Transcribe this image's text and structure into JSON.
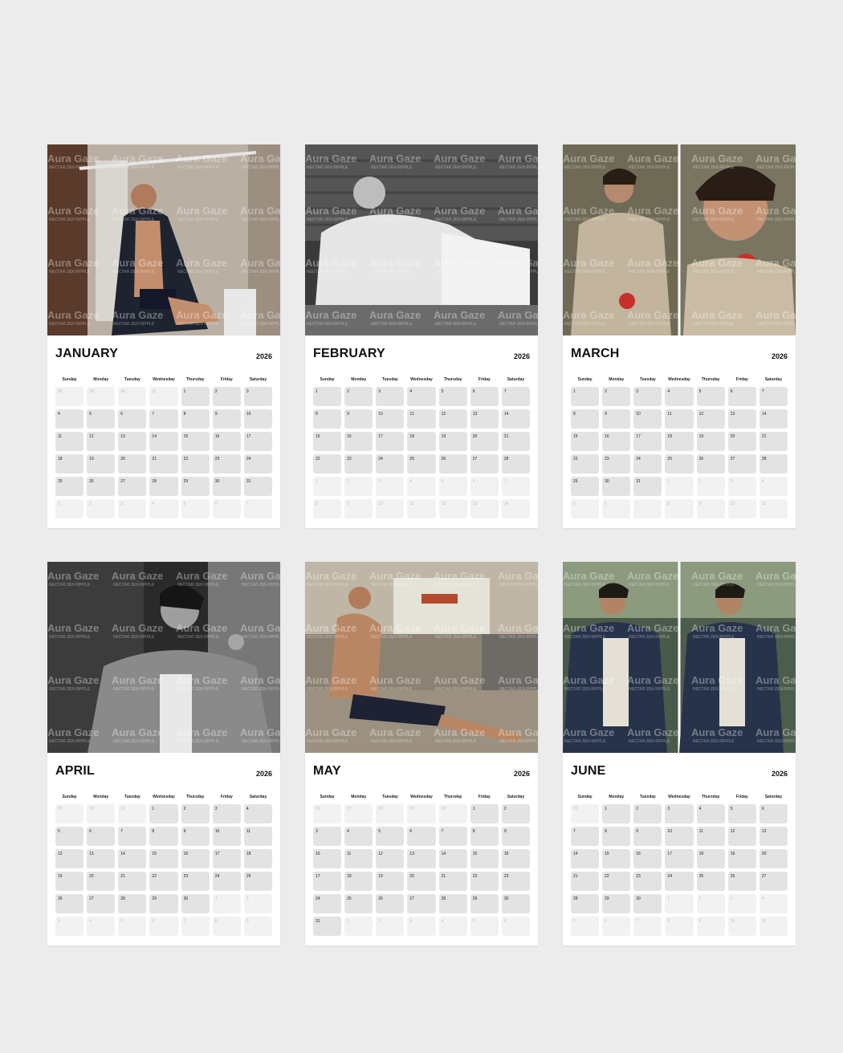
{
  "year": "2026",
  "weekdays": [
    "Sunday",
    "Monday",
    "Tuesday",
    "Wednesday",
    "Thursday",
    "Friday",
    "Saturday"
  ],
  "watermark": {
    "brand": "Aura Gaze",
    "tagline": "NECTAR ZEN RIPPLE"
  },
  "months": [
    {
      "name": "JANUARY",
      "photo": "shirtless-man-in-robe-at-window",
      "days": [
        [
          "28",
          1
        ],
        [
          "29",
          1
        ],
        [
          "30",
          1
        ],
        [
          "31",
          1
        ],
        [
          "1",
          0
        ],
        [
          "2",
          0
        ],
        [
          "3",
          0
        ],
        [
          "4",
          0
        ],
        [
          "5",
          0
        ],
        [
          "6",
          0
        ],
        [
          "7",
          0
        ],
        [
          "8",
          0
        ],
        [
          "9",
          0
        ],
        [
          "10",
          0
        ],
        [
          "11",
          0
        ],
        [
          "12",
          0
        ],
        [
          "13",
          0
        ],
        [
          "14",
          0
        ],
        [
          "15",
          0
        ],
        [
          "16",
          0
        ],
        [
          "17",
          0
        ],
        [
          "18",
          0
        ],
        [
          "19",
          0
        ],
        [
          "20",
          0
        ],
        [
          "21",
          0
        ],
        [
          "22",
          0
        ],
        [
          "23",
          0
        ],
        [
          "24",
          0
        ],
        [
          "25",
          0
        ],
        [
          "26",
          0
        ],
        [
          "27",
          0
        ],
        [
          "28",
          0
        ],
        [
          "29",
          0
        ],
        [
          "30",
          0
        ],
        [
          "31",
          0
        ],
        [
          "1",
          1
        ],
        [
          "2",
          1
        ],
        [
          "3",
          1
        ],
        [
          "4",
          1
        ],
        [
          "5",
          1
        ],
        [
          "6",
          1
        ],
        [
          "7",
          1
        ]
      ]
    },
    {
      "name": "FEBRUARY",
      "photo": "man-in-white-sweater-reclining-bw",
      "days": [
        [
          "1",
          0
        ],
        [
          "2",
          0
        ],
        [
          "3",
          0
        ],
        [
          "4",
          0
        ],
        [
          "5",
          0
        ],
        [
          "6",
          0
        ],
        [
          "7",
          0
        ],
        [
          "8",
          0
        ],
        [
          "9",
          0
        ],
        [
          "10",
          0
        ],
        [
          "11",
          0
        ],
        [
          "12",
          0
        ],
        [
          "13",
          0
        ],
        [
          "14",
          0
        ],
        [
          "15",
          0
        ],
        [
          "16",
          0
        ],
        [
          "17",
          0
        ],
        [
          "18",
          0
        ],
        [
          "19",
          0
        ],
        [
          "20",
          0
        ],
        [
          "21",
          0
        ],
        [
          "22",
          0
        ],
        [
          "23",
          0
        ],
        [
          "24",
          0
        ],
        [
          "25",
          0
        ],
        [
          "26",
          0
        ],
        [
          "27",
          0
        ],
        [
          "28",
          0
        ],
        [
          "1",
          1
        ],
        [
          "2",
          1
        ],
        [
          "3",
          1
        ],
        [
          "4",
          1
        ],
        [
          "5",
          1
        ],
        [
          "6",
          1
        ],
        [
          "7",
          1
        ],
        [
          "8",
          1
        ],
        [
          "9",
          1
        ],
        [
          "10",
          1
        ],
        [
          "11",
          1
        ],
        [
          "12",
          1
        ],
        [
          "13",
          1
        ],
        [
          "14",
          1
        ]
      ]
    },
    {
      "name": "MARCH",
      "photo": "man-in-coat-with-apple-two-panels",
      "days": [
        [
          "1",
          0
        ],
        [
          "2",
          0
        ],
        [
          "3",
          0
        ],
        [
          "4",
          0
        ],
        [
          "5",
          0
        ],
        [
          "6",
          0
        ],
        [
          "7",
          0
        ],
        [
          "8",
          0
        ],
        [
          "9",
          0
        ],
        [
          "10",
          0
        ],
        [
          "11",
          0
        ],
        [
          "12",
          0
        ],
        [
          "13",
          0
        ],
        [
          "14",
          0
        ],
        [
          "15",
          0
        ],
        [
          "16",
          0
        ],
        [
          "17",
          0
        ],
        [
          "18",
          0
        ],
        [
          "19",
          0
        ],
        [
          "20",
          0
        ],
        [
          "21",
          0
        ],
        [
          "22",
          0
        ],
        [
          "23",
          0
        ],
        [
          "24",
          0
        ],
        [
          "25",
          0
        ],
        [
          "26",
          0
        ],
        [
          "27",
          0
        ],
        [
          "28",
          0
        ],
        [
          "29",
          0
        ],
        [
          "30",
          0
        ],
        [
          "31",
          0
        ],
        [
          "1",
          1
        ],
        [
          "2",
          1
        ],
        [
          "3",
          1
        ],
        [
          "4",
          1
        ],
        [
          "5",
          1
        ],
        [
          "6",
          1
        ],
        [
          "7",
          1
        ],
        [
          "8",
          1
        ],
        [
          "9",
          1
        ],
        [
          "10",
          1
        ],
        [
          "11",
          1
        ]
      ]
    },
    {
      "name": "APRIL",
      "photo": "man-in-jacket-seated-bw",
      "days": [
        [
          "29",
          1
        ],
        [
          "30",
          1
        ],
        [
          "31",
          1
        ],
        [
          "1",
          0
        ],
        [
          "2",
          0
        ],
        [
          "3",
          0
        ],
        [
          "4",
          0
        ],
        [
          "5",
          0
        ],
        [
          "6",
          0
        ],
        [
          "7",
          0
        ],
        [
          "8",
          0
        ],
        [
          "9",
          0
        ],
        [
          "10",
          0
        ],
        [
          "11",
          0
        ],
        [
          "12",
          0
        ],
        [
          "13",
          0
        ],
        [
          "14",
          0
        ],
        [
          "15",
          0
        ],
        [
          "16",
          0
        ],
        [
          "17",
          0
        ],
        [
          "18",
          0
        ],
        [
          "19",
          0
        ],
        [
          "20",
          0
        ],
        [
          "21",
          0
        ],
        [
          "22",
          0
        ],
        [
          "23",
          0
        ],
        [
          "24",
          0
        ],
        [
          "25",
          0
        ],
        [
          "26",
          0
        ],
        [
          "27",
          0
        ],
        [
          "28",
          0
        ],
        [
          "29",
          0
        ],
        [
          "30",
          0
        ],
        [
          "1",
          1
        ],
        [
          "2",
          1
        ],
        [
          "3",
          1
        ],
        [
          "4",
          1
        ],
        [
          "5",
          1
        ],
        [
          "6",
          1
        ],
        [
          "7",
          1
        ],
        [
          "8",
          1
        ],
        [
          "9",
          1
        ]
      ]
    },
    {
      "name": "MAY",
      "photo": "shirtless-man-doing-plank-in-loft",
      "days": [
        [
          "26",
          1
        ],
        [
          "27",
          1
        ],
        [
          "28",
          1
        ],
        [
          "29",
          1
        ],
        [
          "30",
          1
        ],
        [
          "1",
          0
        ],
        [
          "2",
          0
        ],
        [
          "3",
          0
        ],
        [
          "4",
          0
        ],
        [
          "5",
          0
        ],
        [
          "6",
          0
        ],
        [
          "7",
          0
        ],
        [
          "8",
          0
        ],
        [
          "9",
          0
        ],
        [
          "10",
          0
        ],
        [
          "11",
          0
        ],
        [
          "12",
          0
        ],
        [
          "13",
          0
        ],
        [
          "14",
          0
        ],
        [
          "15",
          0
        ],
        [
          "16",
          0
        ],
        [
          "17",
          0
        ],
        [
          "18",
          0
        ],
        [
          "19",
          0
        ],
        [
          "20",
          0
        ],
        [
          "21",
          0
        ],
        [
          "22",
          0
        ],
        [
          "23",
          0
        ],
        [
          "24",
          0
        ],
        [
          "25",
          0
        ],
        [
          "26",
          0
        ],
        [
          "27",
          0
        ],
        [
          "28",
          0
        ],
        [
          "29",
          0
        ],
        [
          "30",
          0
        ],
        [
          "31",
          0
        ],
        [
          "1",
          1
        ],
        [
          "2",
          1
        ],
        [
          "3",
          1
        ],
        [
          "4",
          1
        ],
        [
          "5",
          1
        ],
        [
          "6",
          1
        ]
      ]
    },
    {
      "name": "JUNE",
      "photo": "man-in-denim-jacket-two-panels",
      "days": [
        [
          "31",
          1
        ],
        [
          "1",
          0
        ],
        [
          "2",
          0
        ],
        [
          "3",
          0
        ],
        [
          "4",
          0
        ],
        [
          "5",
          0
        ],
        [
          "6",
          0
        ],
        [
          "7",
          0
        ],
        [
          "8",
          0
        ],
        [
          "9",
          0
        ],
        [
          "10",
          0
        ],
        [
          "11",
          0
        ],
        [
          "12",
          0
        ],
        [
          "13",
          0
        ],
        [
          "14",
          0
        ],
        [
          "15",
          0
        ],
        [
          "16",
          0
        ],
        [
          "17",
          0
        ],
        [
          "18",
          0
        ],
        [
          "19",
          0
        ],
        [
          "20",
          0
        ],
        [
          "21",
          0
        ],
        [
          "22",
          0
        ],
        [
          "23",
          0
        ],
        [
          "24",
          0
        ],
        [
          "25",
          0
        ],
        [
          "26",
          0
        ],
        [
          "27",
          0
        ],
        [
          "28",
          0
        ],
        [
          "29",
          0
        ],
        [
          "30",
          0
        ],
        [
          "1",
          1
        ],
        [
          "2",
          1
        ],
        [
          "3",
          1
        ],
        [
          "4",
          1
        ],
        [
          "5",
          1
        ],
        [
          "6",
          1
        ],
        [
          "7",
          1
        ],
        [
          "8",
          1
        ],
        [
          "9",
          1
        ],
        [
          "10",
          1
        ],
        [
          "11",
          1
        ]
      ]
    }
  ]
}
